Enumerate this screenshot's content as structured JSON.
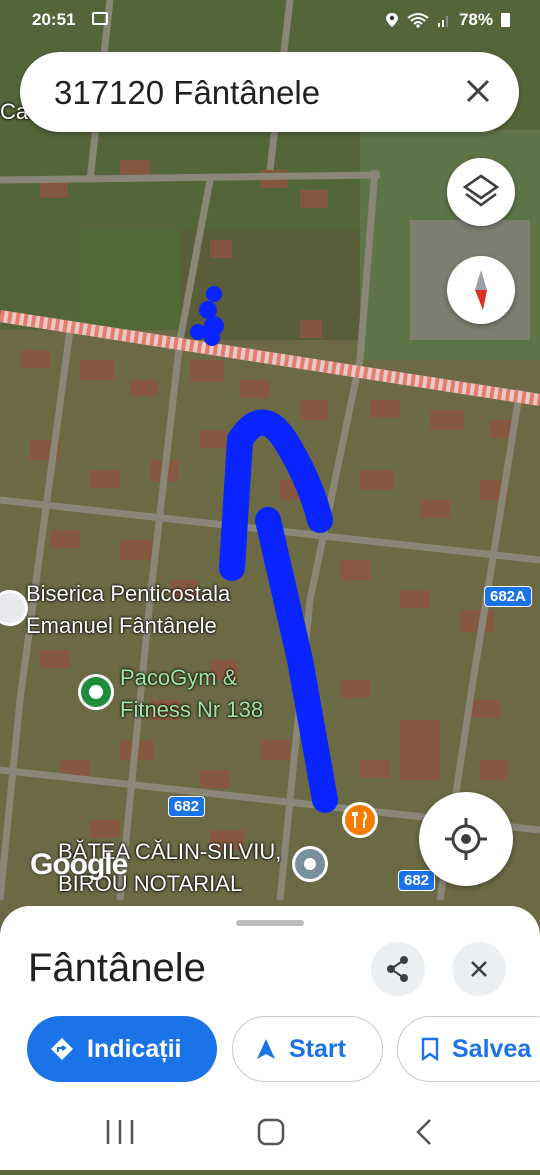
{
  "status_bar": {
    "time": "20:51",
    "battery": "78%"
  },
  "search": {
    "query": "317120 Fântânele"
  },
  "map": {
    "labels": {
      "church": [
        "Biserica Penticostala",
        "Emanuel Fântânele"
      ],
      "gym": [
        "PacoGym &",
        "Fitness Nr 138"
      ],
      "notary": [
        "BĂTEA CĂLIN-SILVIU,",
        "BIROU NOTARIAL"
      ],
      "partial_top_left": "Cas"
    },
    "road_badges": {
      "r1": "682A",
      "r2": "682",
      "r3": "682"
    },
    "attribution": "Google",
    "icons": [
      "layers-icon",
      "compass-icon",
      "my-location-icon",
      "restaurant-pin",
      "place-pin"
    ]
  },
  "sheet": {
    "place_name": "Fântânele",
    "actions": {
      "directions": "Indicații",
      "start": "Start",
      "save": "Salvea"
    }
  },
  "colors": {
    "accent": "#1a73e8",
    "drawing": "#0a24ff",
    "restaurant": "#f57c00",
    "gym": "#1e8e3e"
  }
}
